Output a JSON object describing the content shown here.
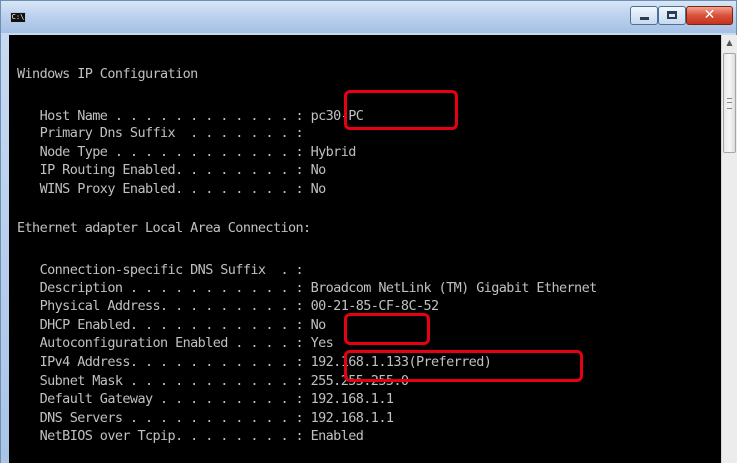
{
  "window": {
    "icon_text": "C:\\",
    "title": "",
    "close_glyph": "✕"
  },
  "console": {
    "lines": [
      "Windows IP Configuration",
      "",
      "   Host Name . . . . . . . . . . . . : pc30-PC",
      "   Primary Dns Suffix  . . . . . . . :",
      "   Node Type . . . . . . . . . . . . : Hybrid",
      "   IP Routing Enabled. . . . . . . . : No",
      "   WINS Proxy Enabled. . . . . . . . : No",
      "",
      "Ethernet adapter Local Area Connection:",
      "",
      "   Connection-specific DNS Suffix  . :",
      "   Description . . . . . . . . . . . : Broadcom NetLink (TM) Gigabit Ethernet",
      "   Physical Address. . . . . . . . . : 00-21-85-CF-8C-52",
      "   DHCP Enabled. . . . . . . . . . . : No",
      "   Autoconfiguration Enabled . . . . : Yes",
      "   IPv4 Address. . . . . . . . . . . : 192.168.1.133(Preferred)",
      "   Subnet Mask . . . . . . . . . . . : 255.255.255.0",
      "   Default Gateway . . . . . . . . . : 192.168.1.1",
      "   DNS Servers . . . . . . . . . . . : 192.168.1.1",
      "   NetBIOS over Tcpip. . . . . . . . : Enabled"
    ]
  },
  "colors": {
    "highlight": "#e60012",
    "console_bg": "#000000",
    "console_text": "#c0c0c0"
  }
}
